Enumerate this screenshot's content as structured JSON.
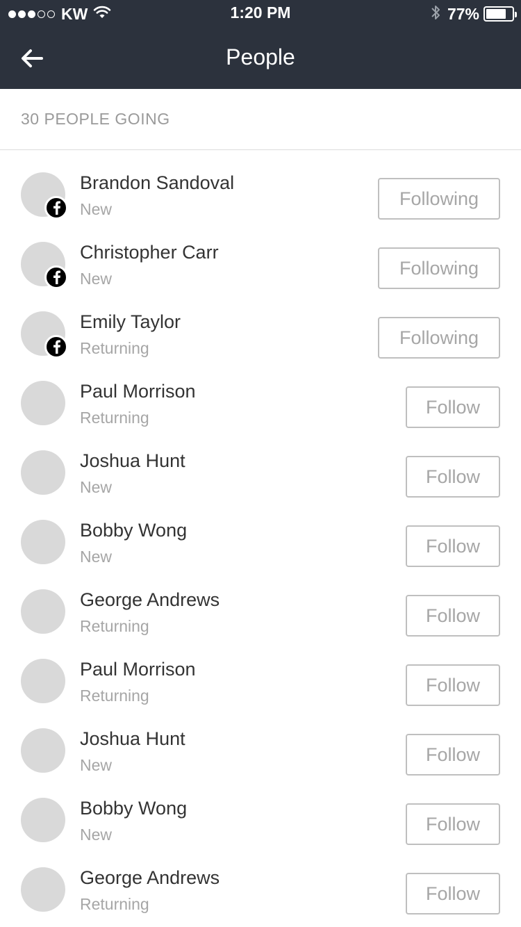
{
  "status_bar": {
    "carrier": "KW",
    "signal_bars": 3,
    "signal_total": 5,
    "time": "1:20 PM",
    "battery_percent": "77%",
    "battery_level": 0.77,
    "icons": [
      "signal-dots-icon",
      "wifi-icon",
      "bluetooth-icon",
      "battery-icon"
    ]
  },
  "nav": {
    "title": "People",
    "back_icon": "arrow-left-icon"
  },
  "summary": {
    "count_label": "30 PEOPLE GOING"
  },
  "colors": {
    "header_bg": "#2c323d",
    "avatar_placeholder": "#d9d9d9",
    "badge_bg": "#000000",
    "secondary_text": "#a6a6a6"
  },
  "people": [
    {
      "name": "Brandon Sandoval",
      "status": "New",
      "button": "Following",
      "badge": "facebook-icon"
    },
    {
      "name": "Christopher Carr",
      "status": "New",
      "button": "Following",
      "badge": "facebook-icon"
    },
    {
      "name": "Emily Taylor",
      "status": "Returning",
      "button": "Following",
      "badge": "facebook-icon"
    },
    {
      "name": "Paul Morrison",
      "status": "Returning",
      "button": "Follow"
    },
    {
      "name": "Joshua Hunt",
      "status": "New",
      "button": "Follow"
    },
    {
      "name": "Bobby Wong",
      "status": "New",
      "button": "Follow"
    },
    {
      "name": "George Andrews",
      "status": "Returning",
      "button": "Follow"
    },
    {
      "name": "Paul Morrison",
      "status": "Returning",
      "button": "Follow"
    },
    {
      "name": "Joshua Hunt",
      "status": "New",
      "button": "Follow"
    },
    {
      "name": "Bobby Wong",
      "status": "New",
      "button": "Follow"
    },
    {
      "name": "George Andrews",
      "status": "Returning",
      "button": "Follow"
    }
  ]
}
